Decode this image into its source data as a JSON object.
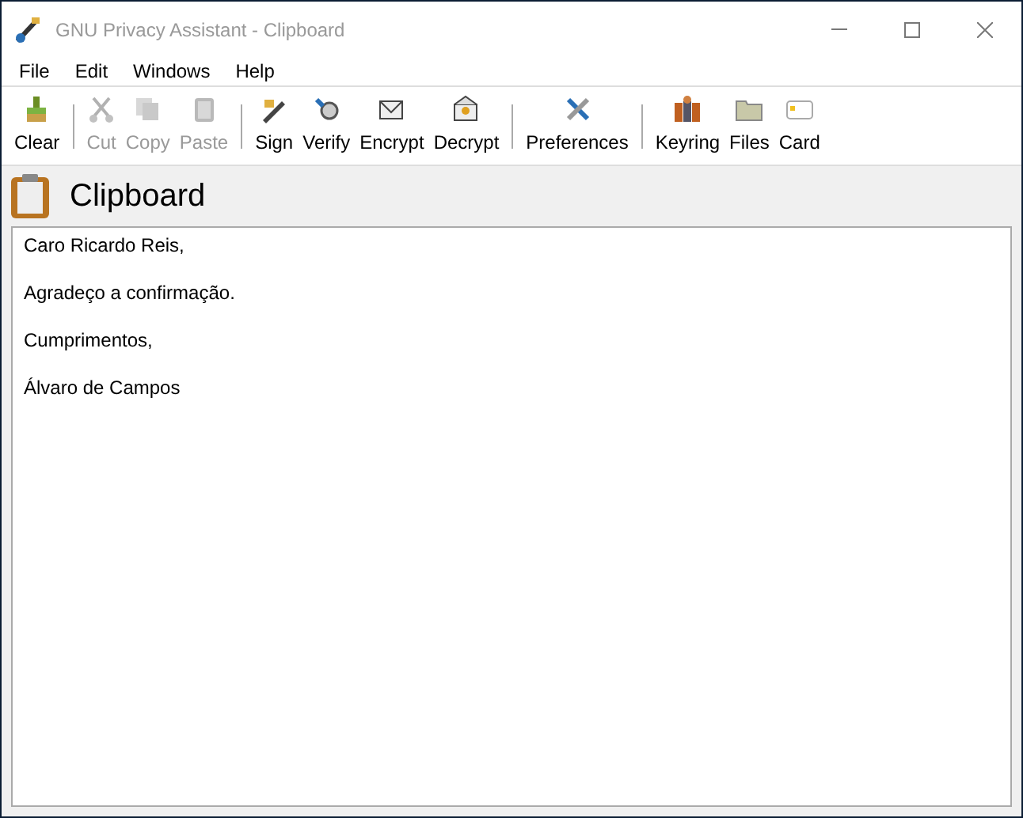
{
  "window": {
    "title": "GNU Privacy Assistant - Clipboard"
  },
  "menu": [
    "File",
    "Edit",
    "Windows",
    "Help"
  ],
  "toolbar": [
    [
      {
        "label": "Clear",
        "kind": "clear",
        "disabled": false
      }
    ],
    [
      {
        "label": "Cut",
        "kind": "cut",
        "disabled": true
      },
      {
        "label": "Copy",
        "kind": "copy",
        "disabled": true
      },
      {
        "label": "Paste",
        "kind": "paste",
        "disabled": true
      }
    ],
    [
      {
        "label": "Sign",
        "kind": "sign",
        "disabled": false
      },
      {
        "label": "Verify",
        "kind": "verify",
        "disabled": false
      },
      {
        "label": "Encrypt",
        "kind": "encrypt",
        "disabled": false
      },
      {
        "label": "Decrypt",
        "kind": "decrypt",
        "disabled": false
      }
    ],
    [
      {
        "label": "Preferences",
        "kind": "preferences",
        "disabled": false
      }
    ],
    [
      {
        "label": "Keyring",
        "kind": "keyring",
        "disabled": false
      },
      {
        "label": "Files",
        "kind": "files",
        "disabled": false
      },
      {
        "label": "Card",
        "kind": "card",
        "disabled": false
      }
    ]
  ],
  "header": {
    "title": "Clipboard"
  },
  "editor": {
    "lines": [
      "Caro Ricardo Reis,",
      "Agradeço a confirmação.",
      "Cumprimentos,",
      "Álvaro de Campos"
    ]
  }
}
